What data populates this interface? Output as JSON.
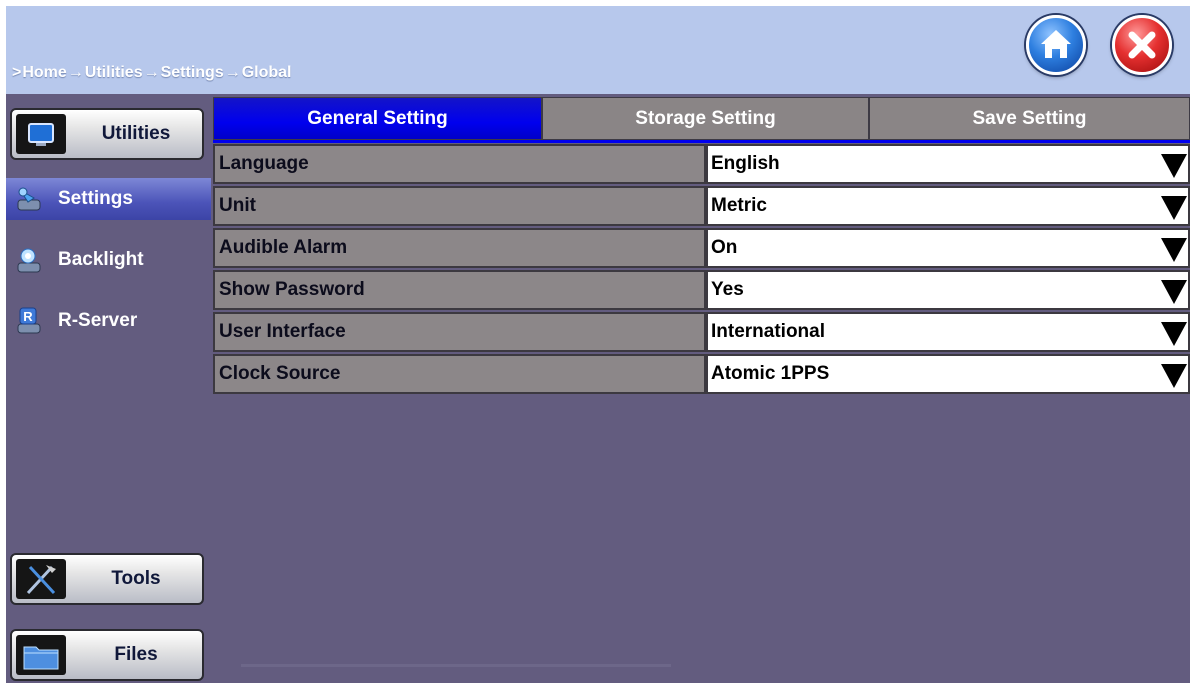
{
  "header": {
    "breadcrumb": [
      {
        "sep": ">",
        "label": "Home"
      },
      {
        "sep": "→",
        "label": "Utilities"
      },
      {
        "sep": "→",
        "label": "Settings"
      },
      {
        "sep": "→",
        "label": "Global"
      }
    ]
  },
  "sidebar": {
    "utilities_label": "Utilities",
    "items": [
      {
        "label": "Settings",
        "icon": "settings-icon",
        "active": true
      },
      {
        "label": "Backlight",
        "icon": "backlight-icon",
        "active": false
      },
      {
        "label": "R-Server",
        "icon": "r-server-icon",
        "active": false
      }
    ],
    "tools_label": "Tools",
    "files_label": "Files"
  },
  "tabs": [
    {
      "label": "General Setting",
      "active": true
    },
    {
      "label": "Storage Setting",
      "active": false
    },
    {
      "label": "Save Setting",
      "active": false
    }
  ],
  "settings": [
    {
      "label": "Language",
      "value": "English"
    },
    {
      "label": "Unit",
      "value": "Metric"
    },
    {
      "label": "Audible Alarm",
      "value": "On"
    },
    {
      "label": "Show Password",
      "value": "Yes"
    },
    {
      "label": "User Interface",
      "value": "International"
    },
    {
      "label": "Clock Source",
      "value": "Atomic 1PPS"
    }
  ],
  "colors": {
    "header_bg": "#b7c8ec",
    "panel_bg": "#635c7f",
    "active_tab": "#0000ee",
    "inactive_tab": "#8a8586",
    "label_cell": "#8c8789",
    "value_cell": "#ffffff"
  }
}
